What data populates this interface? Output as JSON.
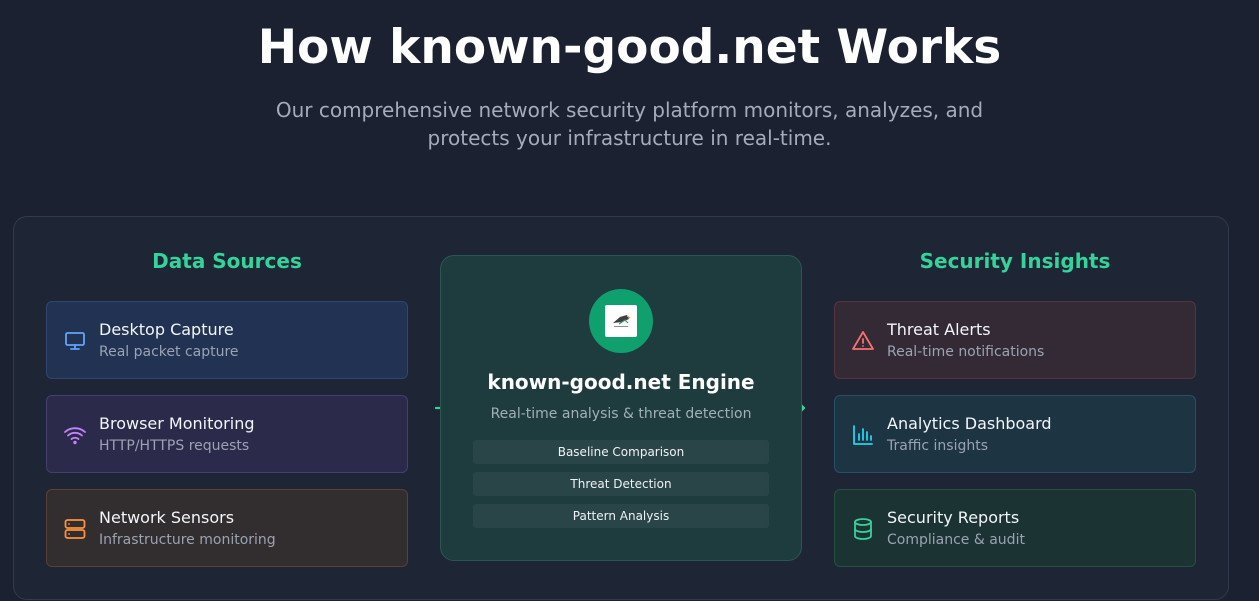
{
  "hero": {
    "title": "How known-good.net Works",
    "subtitle": "Our comprehensive network security platform monitors, analyzes, and protects your infrastructure in real-time."
  },
  "left": {
    "title": "Data Sources",
    "items": [
      {
        "title": "Desktop Capture",
        "sub": "Real packet capture",
        "icon": "monitor-icon",
        "color": "#60a5fa"
      },
      {
        "title": "Browser Monitoring",
        "sub": "HTTP/HTTPS requests",
        "icon": "wifi-icon",
        "color": "#c084fc"
      },
      {
        "title": "Network Sensors",
        "sub": "Infrastructure monitoring",
        "icon": "server-icon",
        "color": "#fb923c"
      }
    ]
  },
  "engine": {
    "name": "known-good.net Engine",
    "tagline": "Real-time analysis & threat detection",
    "features": [
      "Baseline Comparison",
      "Threat Detection",
      "Pattern Analysis"
    ]
  },
  "right": {
    "title": "Security Insights",
    "items": [
      {
        "title": "Threat Alerts",
        "sub": "Real-time notifications",
        "icon": "alert-triangle-icon",
        "color": "#f87171"
      },
      {
        "title": "Analytics Dashboard",
        "sub": "Traffic insights",
        "icon": "bar-chart-icon",
        "color": "#22d3ee"
      },
      {
        "title": "Security Reports",
        "sub": "Compliance & audit",
        "icon": "database-icon",
        "color": "#34d399"
      }
    ]
  },
  "colors": {
    "accent": "#34d399",
    "background": "#1b2130"
  }
}
